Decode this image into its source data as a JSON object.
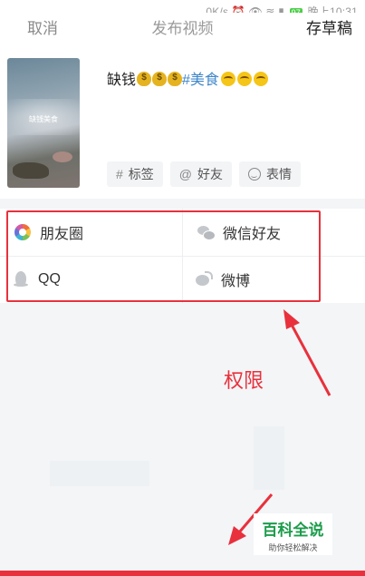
{
  "status_bar": {
    "net_speed": "0K/s",
    "battery": "97",
    "time": "晚上10:31"
  },
  "nav": {
    "cancel": "取消",
    "title": "发布视频",
    "draft": "存草稿"
  },
  "post": {
    "thumbnail_text": "缺钱美食",
    "caption_prefix": "缺钱",
    "caption_hashtag": "#美食"
  },
  "chips": [
    {
      "icon": "#",
      "label": "标签"
    },
    {
      "icon": "@",
      "label": "好友"
    },
    {
      "icon": "smile",
      "label": "表情"
    }
  ],
  "share": {
    "moments": "朋友圈",
    "wechat": "微信好友",
    "qq": "QQ",
    "weibo": "微博"
  },
  "annotation": {
    "label": "权限"
  },
  "watermark": {
    "title": "百科全说",
    "subtitle": "助你轻松解决"
  },
  "colors": {
    "accent_red": "#e8313c",
    "hashtag_blue": "#3f86c9",
    "watermark_green": "#1c9c4b"
  }
}
